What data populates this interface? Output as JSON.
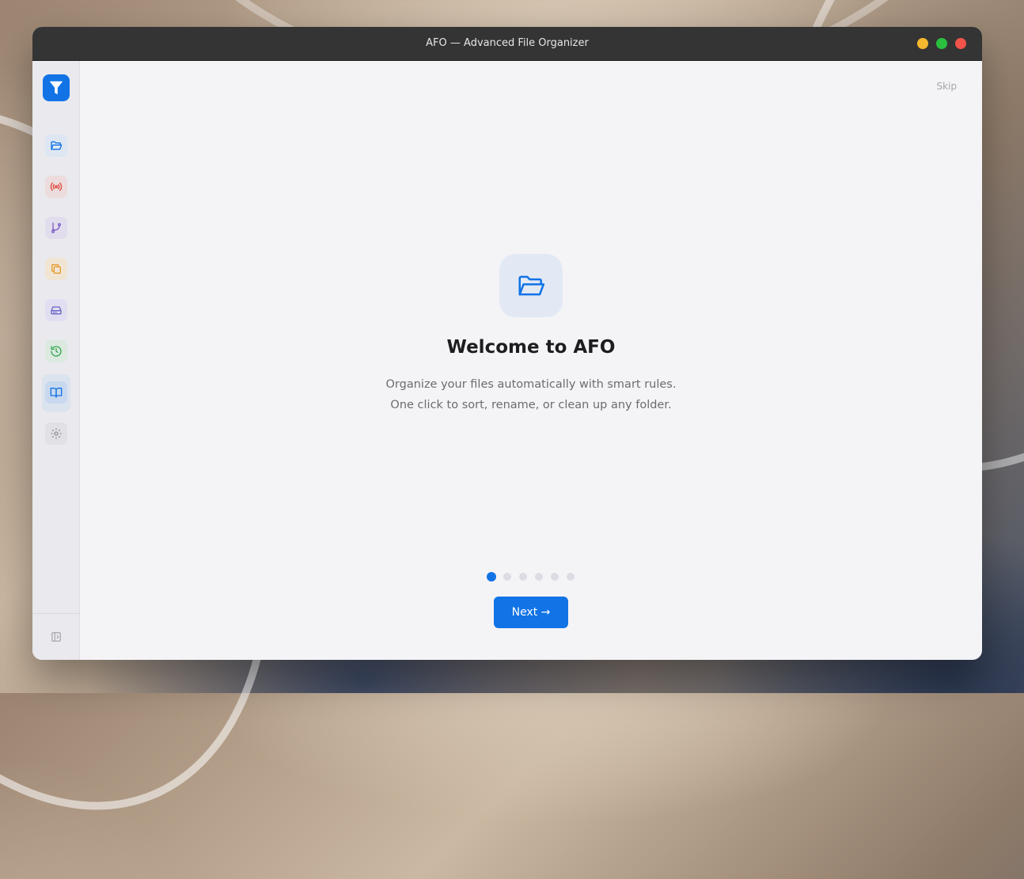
{
  "window": {
    "title": "AFO — Advanced File Organizer"
  },
  "sidebar": {
    "logo_icon": "funnel-icon",
    "items": [
      {
        "name": "folders",
        "icon": "folder-open-icon",
        "color": "#1173e6",
        "bg": "#dde6f2"
      },
      {
        "name": "monitor",
        "icon": "broadcast-icon",
        "color": "#e0453a",
        "bg": "#ecdcdd"
      },
      {
        "name": "rules",
        "icon": "git-branch-icon",
        "color": "#7b5cc9",
        "bg": "#e2ddec"
      },
      {
        "name": "duplicates",
        "icon": "copy-icon",
        "color": "#e69a2e",
        "bg": "#f0e4d3"
      },
      {
        "name": "drives",
        "icon": "hard-drive-icon",
        "color": "#6a64c7",
        "bg": "#e0def0"
      },
      {
        "name": "history",
        "icon": "history-icon",
        "color": "#32a852",
        "bg": "#dbe9df"
      },
      {
        "name": "guide",
        "icon": "book-open-icon",
        "color": "#1173e6",
        "bg": "#c8d8ee",
        "active": true
      },
      {
        "name": "settings",
        "icon": "gear-icon",
        "color": "#8e8e93",
        "bg": "#e0e0e5"
      }
    ],
    "collapse_icon": "sidebar-collapse-icon"
  },
  "main": {
    "skip_label": "Skip",
    "hero_icon": "folder-open-icon",
    "title": "Welcome to AFO",
    "subtitle_line1": "Organize your files automatically with smart rules.",
    "subtitle_line2": "One click to sort, rename, or clean up any folder.",
    "step_current": 1,
    "step_total": 6,
    "next_label": "Next →"
  },
  "colors": {
    "accent": "#1173e6",
    "titlebar": "#343434",
    "traffic_min": "#f5b82e",
    "traffic_max": "#2bbf3f",
    "traffic_close": "#f2534b"
  }
}
